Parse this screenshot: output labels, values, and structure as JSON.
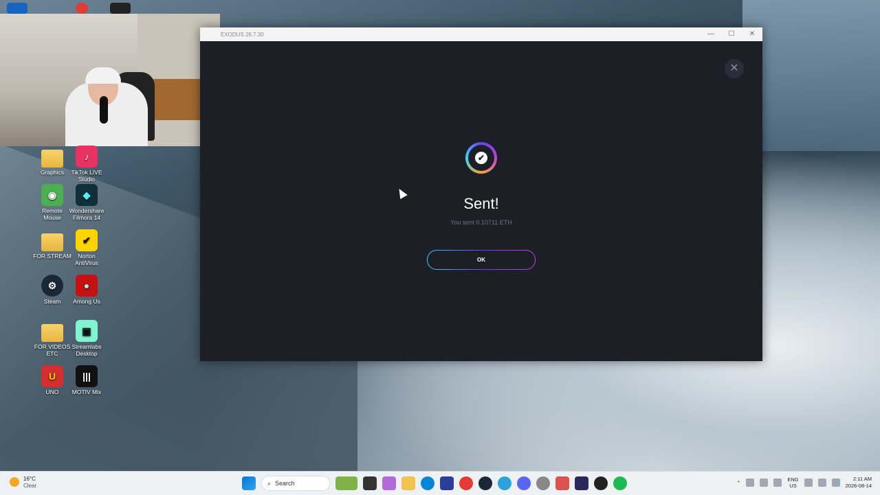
{
  "desktop_icons": [
    {
      "label": "Graphics",
      "color": "#e8b53f",
      "glyph": ""
    },
    {
      "label": "TikTok LIVE Studio",
      "color": "#e83262",
      "glyph": "♪"
    },
    {
      "label": "Remote Mouse",
      "color": "#4caf50",
      "glyph": "◉"
    },
    {
      "label": "Wondershare Filmora 14",
      "color": "#0f2f3a",
      "glyph": "◆"
    },
    {
      "label": "FOR STREAM",
      "color": "#e8b53f",
      "glyph": ""
    },
    {
      "label": "Norton AntiVirus",
      "color": "#ffd400",
      "glyph": "✔"
    },
    {
      "label": "Steam",
      "color": "#1b2838",
      "glyph": "⚙"
    },
    {
      "label": "Among Us",
      "color": "#c51111",
      "glyph": "●"
    },
    {
      "label": "FOR VIDEOS ETC",
      "color": "#e8b53f",
      "glyph": ""
    },
    {
      "label": "Streamlabs Desktop",
      "color": "#80f5d2",
      "glyph": "▣"
    },
    {
      "label": "UNO",
      "color": "#d32f2f",
      "glyph": "U"
    },
    {
      "label": "MOTIV Mix",
      "color": "#111111",
      "glyph": "|||"
    }
  ],
  "window": {
    "title": "EXODUS 26.7.30",
    "minimize": "—",
    "maximize": "☐",
    "close": "✕"
  },
  "dialog": {
    "close_icon": "✕",
    "check_icon": "✔",
    "heading": "Sent!",
    "message": "You sent 0.10711 ETH",
    "ok_label": "OK"
  },
  "taskbar": {
    "weather_temp": "16°C",
    "weather_cond": "Clear",
    "search_placeholder": "Search",
    "lang_top": "ENG",
    "lang_bottom": "US",
    "time": "2:11 AM",
    "date": "2026-08-14"
  }
}
